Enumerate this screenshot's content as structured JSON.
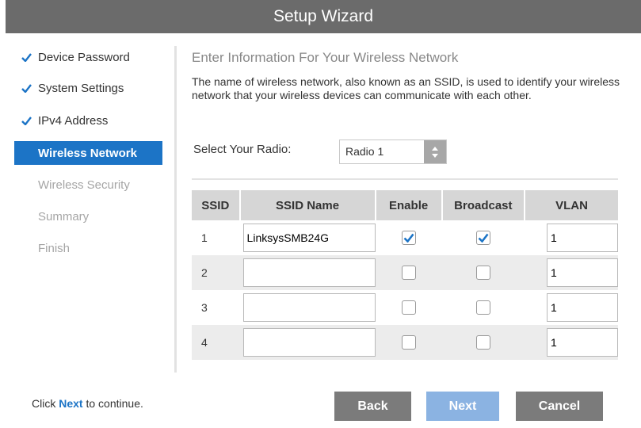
{
  "title": "Setup Wizard",
  "steps": [
    {
      "label": "Device Password",
      "state": "done"
    },
    {
      "label": "System Settings",
      "state": "done"
    },
    {
      "label": "IPv4 Address",
      "state": "done"
    },
    {
      "label": "Wireless Network",
      "state": "active"
    },
    {
      "label": "Wireless Security",
      "state": "pending"
    },
    {
      "label": "Summary",
      "state": "pending"
    },
    {
      "label": "Finish",
      "state": "pending"
    }
  ],
  "main": {
    "heading": "Enter Information For Your Wireless Network",
    "description": "The name of wireless network, also known as an SSID, is used to identify your wireless network that your wireless devices can communicate with each other.",
    "radio_label": "Select Your Radio:",
    "radio_value": "Radio 1"
  },
  "table": {
    "headers": [
      "SSID",
      "SSID Name",
      "Enable",
      "Broadcast",
      "VLAN"
    ],
    "rows": [
      {
        "ssid": "1",
        "name": "LinksysSMB24G",
        "enable": true,
        "broadcast": true,
        "vlan": "1"
      },
      {
        "ssid": "2",
        "name": "",
        "enable": false,
        "broadcast": false,
        "vlan": "1"
      },
      {
        "ssid": "3",
        "name": "",
        "enable": false,
        "broadcast": false,
        "vlan": "1"
      },
      {
        "ssid": "4",
        "name": "",
        "enable": false,
        "broadcast": false,
        "vlan": "1"
      }
    ]
  },
  "footer": {
    "prefix": "Click ",
    "link": "Next",
    "suffix": " to continue."
  },
  "buttons": {
    "back": "Back",
    "next": "Next",
    "cancel": "Cancel"
  },
  "colors": {
    "accent": "#1c74c6",
    "title_bar": "#6b6b6b",
    "next_button": "#8bb3e2",
    "neutral_button": "#7b7b7b"
  }
}
